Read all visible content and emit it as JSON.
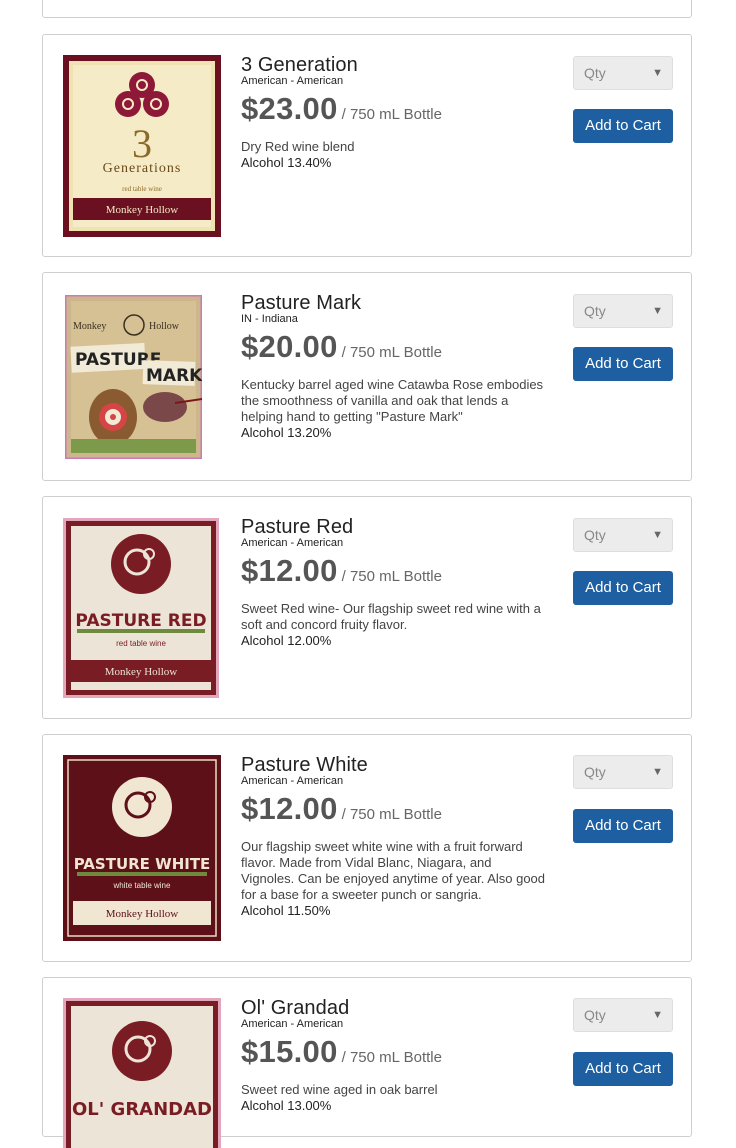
{
  "qty_placeholder": "Qty",
  "caret": "▼",
  "products": [
    {
      "name": "3 Generation",
      "region": "American - American",
      "price": "$23.00",
      "unit": "/ 750 mL Bottle",
      "description": "Dry Red wine blend",
      "alcohol": "Alcohol 13.40%",
      "button": "Add to Cart",
      "label": {
        "big": "3",
        "title": "Generations",
        "sub": "red table wine",
        "brand": "Monkey Hollow"
      }
    },
    {
      "name": "Pasture Mark",
      "region": "IN - Indiana",
      "price": "$20.00",
      "unit": "/ 750 mL Bottle",
      "description": "Kentucky barrel aged wine Catawba Rose embodies the smoothness of vanilla and oak that lends a helping hand to getting \"Pasture Mark\"",
      "alcohol": "Alcohol 13.20%",
      "button": "Add to Cart",
      "label": {
        "brand_left": "Monkey",
        "brand_right": "Hollow",
        "title1": "PASTURE",
        "title2": "MARK"
      }
    },
    {
      "name": "Pasture Red",
      "region": "American - American",
      "price": "$12.00",
      "unit": "/ 750 mL Bottle",
      "description": "Sweet Red wine- Our flagship sweet red wine with a soft and concord fruity flavor.",
      "alcohol": "Alcohol 12.00%",
      "button": "Add to Cart",
      "label": {
        "title": "PASTURE RED",
        "sub": "red table wine",
        "brand": "Monkey Hollow"
      }
    },
    {
      "name": "Pasture White",
      "region": "American - American",
      "price": "$12.00",
      "unit": "/ 750 mL Bottle",
      "description": "Our flagship sweet white wine with a fruit forward flavor. Made from Vidal Blanc, Niagara, and Vignoles. Can be enjoyed anytime of year. Also good for a base for a sweeter punch or sangria.",
      "alcohol": "Alcohol 11.50%",
      "button": "Add to Cart",
      "label": {
        "title": "PASTURE WHITE",
        "sub": "white table wine",
        "brand": "Monkey Hollow"
      }
    },
    {
      "name": "Ol' Grandad",
      "region": "American - American",
      "price": "$15.00",
      "unit": "/ 750 mL Bottle",
      "description": "Sweet red wine aged in oak barrel",
      "alcohol": "Alcohol 13.00%",
      "button": "Add to Cart",
      "label": {
        "title": "OL' GRANDAD"
      }
    }
  ]
}
